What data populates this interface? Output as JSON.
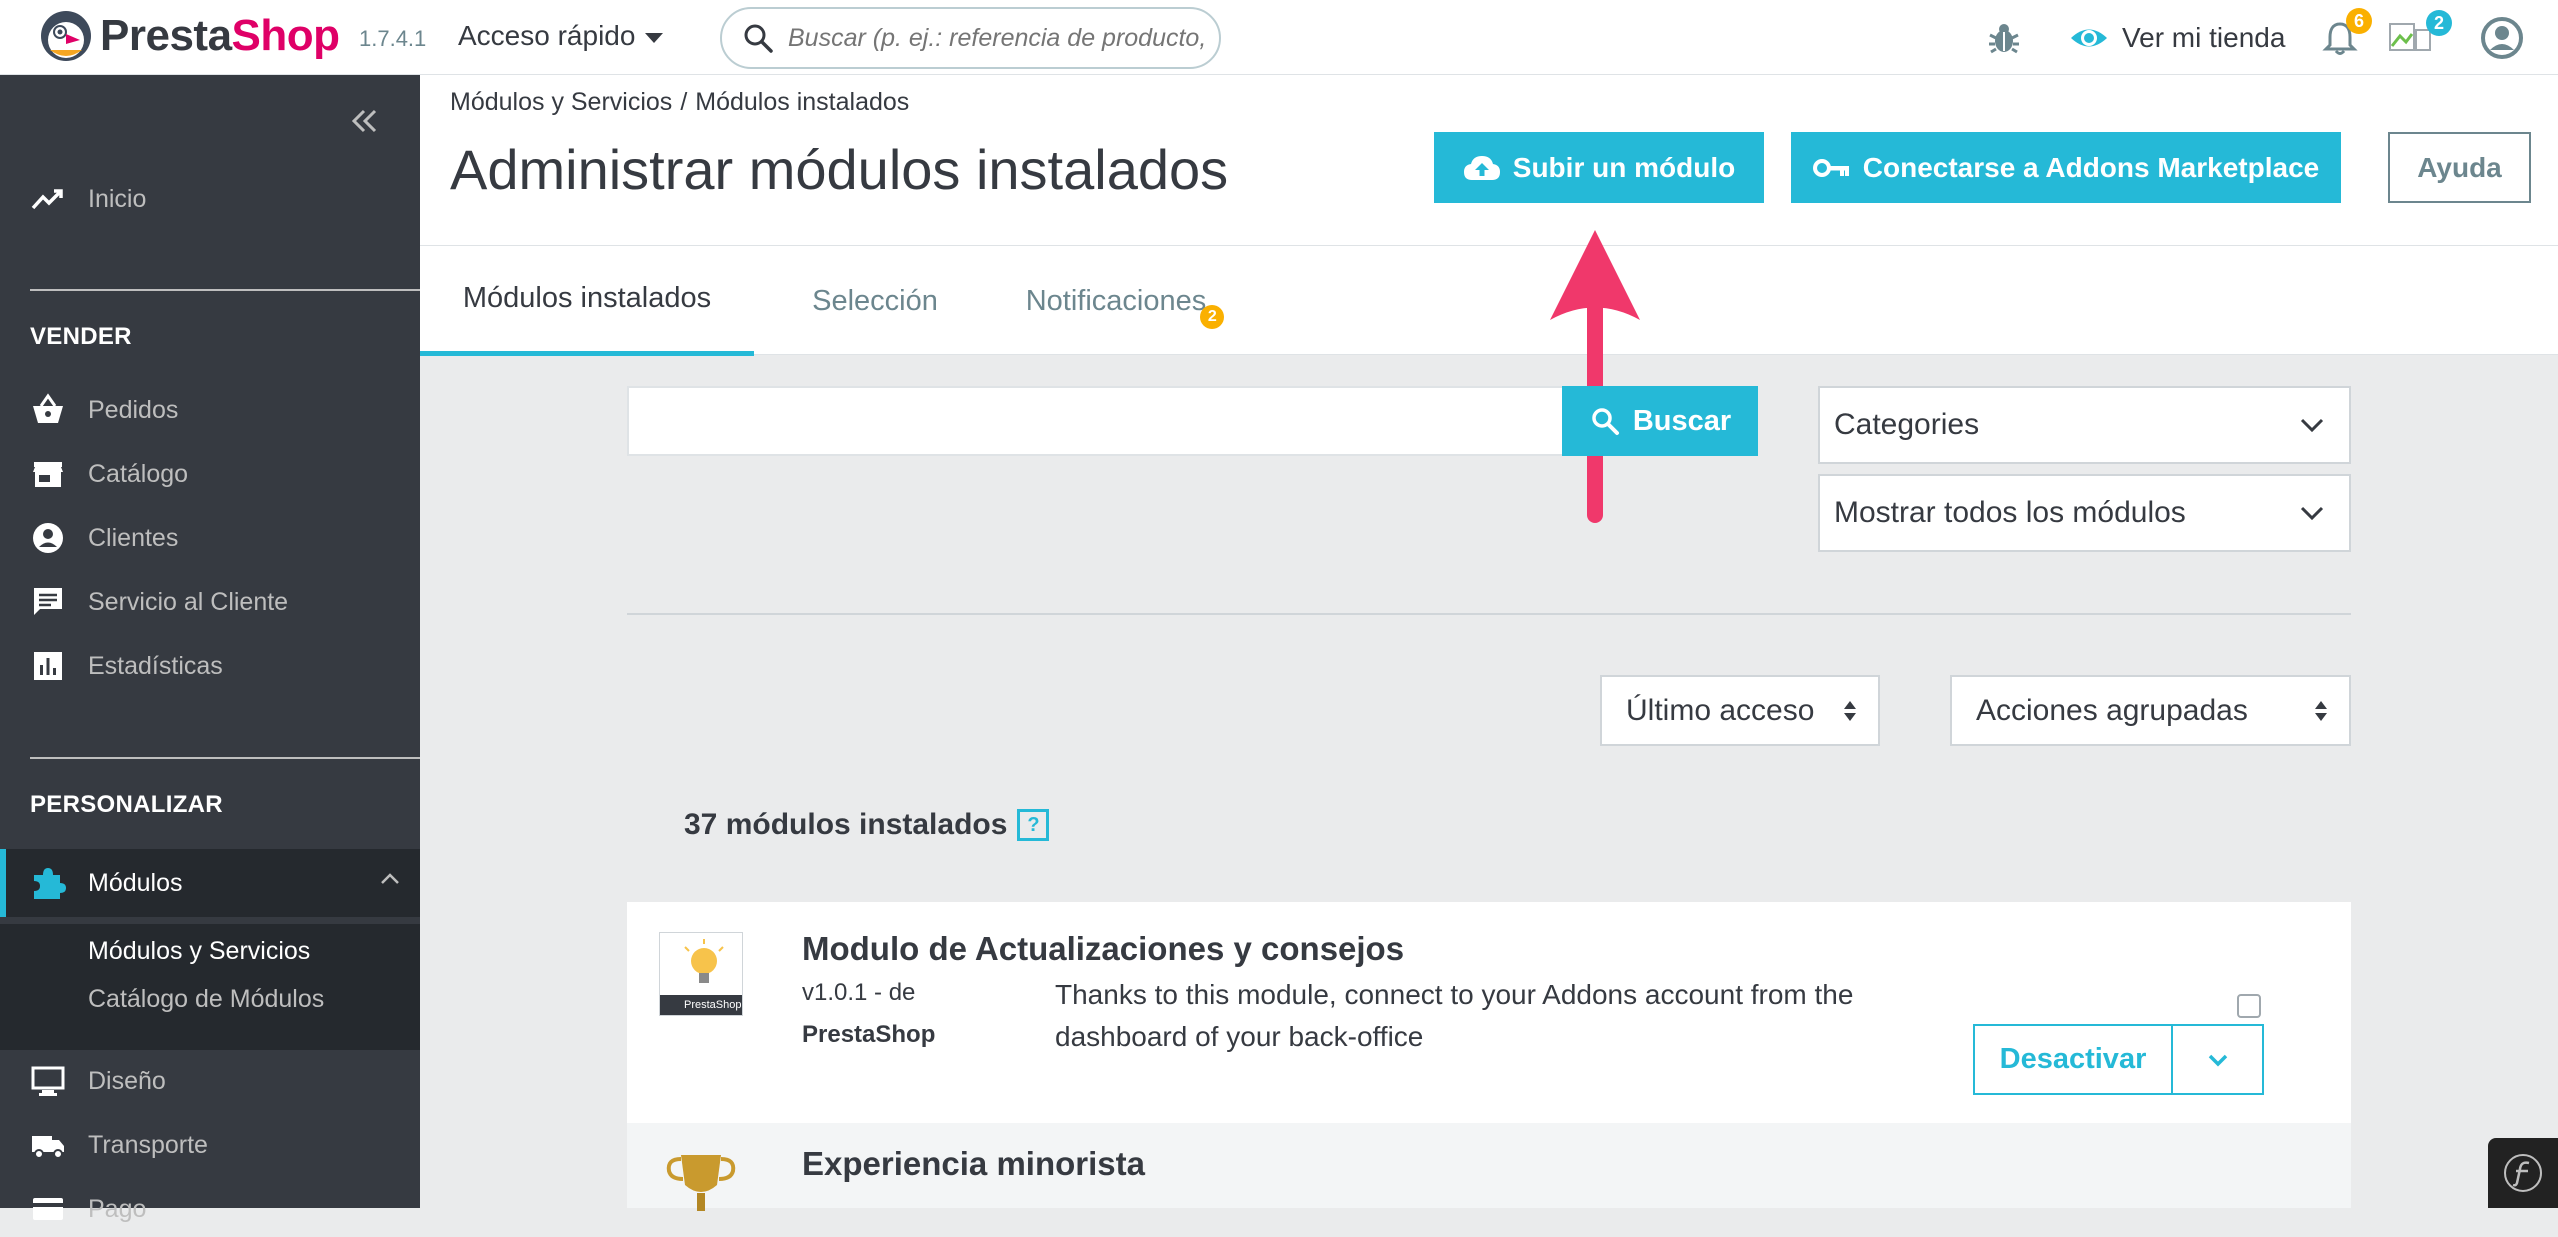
{
  "header": {
    "logo_prefix": "Presta",
    "logo_suffix": "Shop",
    "version": "1.7.4.1",
    "quick_access": "Acceso rápido",
    "search_placeholder": "Buscar (p. ej.: referencia de producto, nombre de cliente...)",
    "view_store": "Ver mi tienda",
    "notifications_count": "6",
    "employee_count": "2"
  },
  "sidebar": {
    "home": "Inicio",
    "section_sell": "VENDER",
    "sell_items": [
      "Pedidos",
      "Catálogo",
      "Clientes",
      "Servicio al Cliente",
      "Estadísticas"
    ],
    "section_customize": "PERSONALIZAR",
    "modules": "Módulos",
    "modules_sub": [
      "Módulos y Servicios",
      "Catálogo de Módulos"
    ],
    "design": "Diseño",
    "shipping": "Transporte",
    "payment": "Pago"
  },
  "page": {
    "breadcrumb_parent": "Módulos y Servicios",
    "breadcrumb_sep": "/",
    "breadcrumb_current": "Módulos instalados",
    "title": "Administrar módulos instalados",
    "upload_button": "Subir un módulo",
    "connect_button": "Conectarse a Addons Marketplace",
    "help_button": "Ayuda",
    "tabs": [
      {
        "label": "Módulos instalados"
      },
      {
        "label": "Selección"
      },
      {
        "label": "Notificaciones",
        "badge": "2"
      }
    ]
  },
  "filters": {
    "search_value": "",
    "search_button": "Buscar",
    "categories": "Categories",
    "show_all": "Mostrar todos los módulos",
    "sort": "Último acceso",
    "bulk_actions": "Acciones agrupadas"
  },
  "modules": {
    "count_text": "37 módulos instalados",
    "help": "?",
    "items": [
      {
        "name": "Modulo de Actualizaciones y consejos",
        "version_line": "v1.0.1 - de",
        "author": "PrestaShop",
        "description": "Thanks to this module, connect to your Addons account from the dashboard of your back-office",
        "action": "Desactivar",
        "thumb_caption": "PrestaShop"
      },
      {
        "name": "Experiencia minorista"
      }
    ]
  },
  "colors": {
    "accent": "#25b9d7",
    "brand": "#df0067",
    "sidebar": "#363a41",
    "badge": "#fab000",
    "arrow": "#f0386b"
  }
}
